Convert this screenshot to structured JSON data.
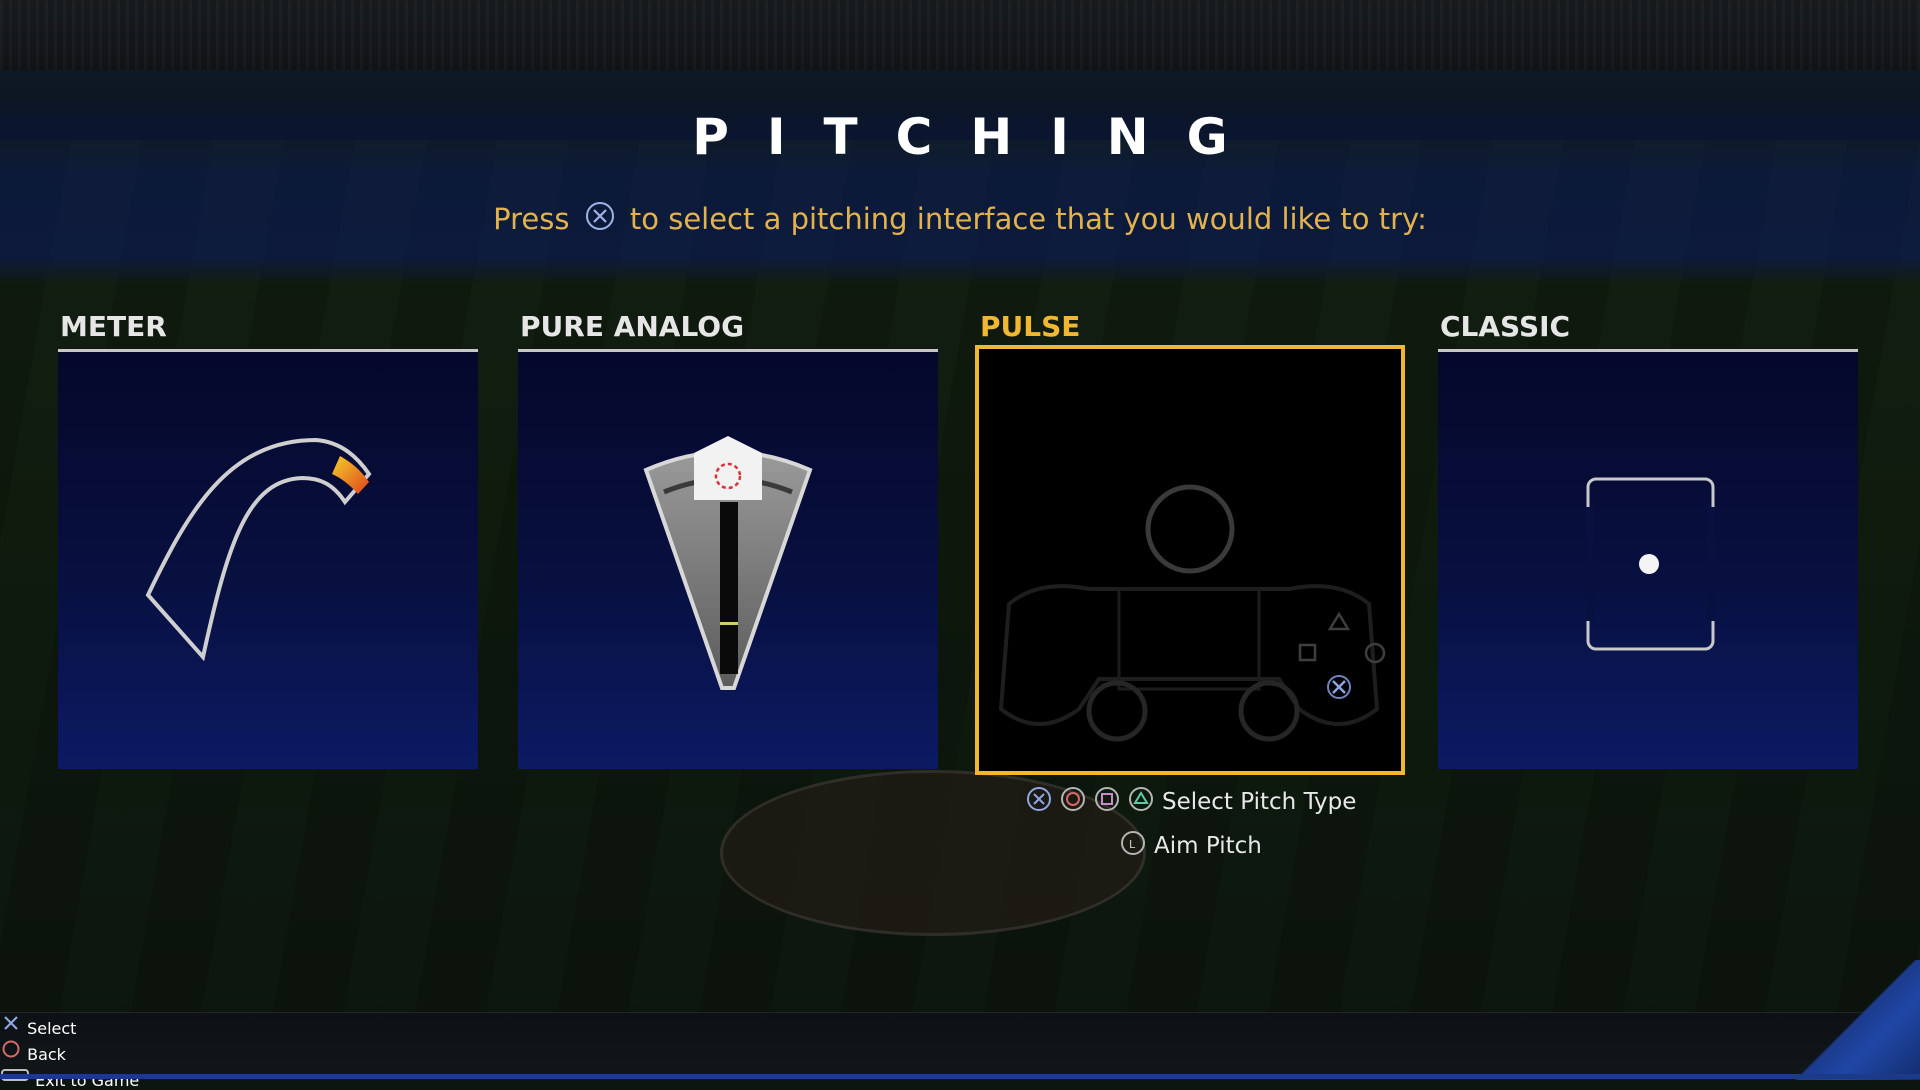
{
  "screen": {
    "title": "PITCHING",
    "instruction_prefix": "Press",
    "instruction_suffix": "to select a pitching interface that you would like to try:",
    "instruction_button_icon": "cross-button-icon"
  },
  "options": [
    {
      "label": "METER",
      "selected": false,
      "preview_icon": "arc-meter-icon"
    },
    {
      "label": "PURE ANALOG",
      "selected": false,
      "preview_icon": "analog-cone-icon"
    },
    {
      "label": "PULSE",
      "selected": true,
      "preview_icon": "controller-pulse-icon"
    },
    {
      "label": "CLASSIC",
      "selected": false,
      "preview_icon": "strike-zone-icon"
    }
  ],
  "pulse_hints": {
    "select_pitch_type": "Select Pitch Type",
    "aim_pitch": "Aim Pitch",
    "select_icons": [
      "cross-button-icon",
      "circle-button-icon",
      "square-button-icon",
      "triangle-button-icon"
    ],
    "aim_icon": "left-stick-icon"
  },
  "footer": {
    "select": "Select",
    "back": "Back",
    "exit": "Exit to Game",
    "select_icon": "cross-button-icon",
    "back_icon": "circle-button-icon",
    "exit_icon": "options-button-icon"
  },
  "colors": {
    "accent": "#f0b731",
    "instruction": "#e2b24e",
    "panel_bg": "#081040",
    "footer_bg": "#111619"
  }
}
